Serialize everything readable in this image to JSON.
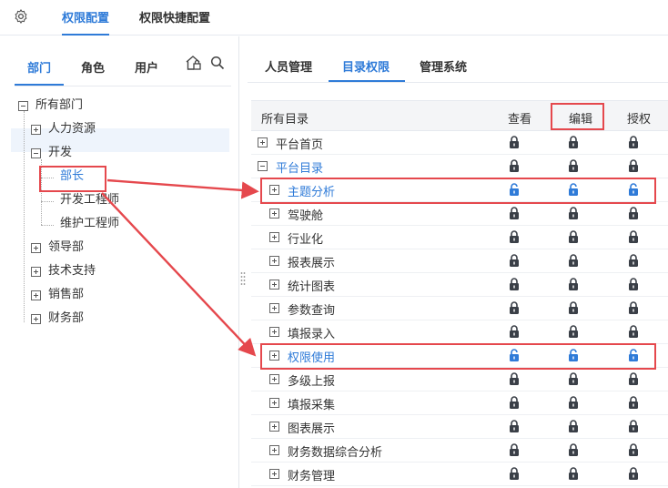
{
  "colors": {
    "accent": "#2f7bd8",
    "annotation": "#e5484d",
    "lock_locked": "#3a3f47",
    "lock_unlocked": "#2f7bd8"
  },
  "top_nav": {
    "settings_icon": "gear-icon",
    "tabs": [
      {
        "label": "权限配置",
        "active": true
      },
      {
        "label": "权限快捷配置",
        "active": false
      }
    ]
  },
  "left_panel": {
    "tabs": [
      {
        "label": "部门",
        "active": true
      },
      {
        "label": "角色",
        "active": false
      },
      {
        "label": "用户",
        "active": false
      }
    ],
    "tools": [
      "lock-home-icon",
      "search-icon"
    ],
    "tree": [
      {
        "label": "所有部门",
        "level": 0,
        "toggle": "minus"
      },
      {
        "label": "人力资源",
        "level": 1,
        "toggle": "plus"
      },
      {
        "label": "开发",
        "level": 1,
        "toggle": "minus"
      },
      {
        "label": "部长",
        "level": 2,
        "toggle": "none",
        "selected": true
      },
      {
        "label": "开发工程师",
        "level": 2,
        "toggle": "none"
      },
      {
        "label": "维护工程师",
        "level": 2,
        "toggle": "none"
      },
      {
        "label": "领导部",
        "level": 1,
        "toggle": "plus"
      },
      {
        "label": "技术支持",
        "level": 1,
        "toggle": "plus"
      },
      {
        "label": "销售部",
        "level": 1,
        "toggle": "plus"
      },
      {
        "label": "财务部",
        "level": 1,
        "toggle": "plus"
      }
    ]
  },
  "right_panel": {
    "tabs": [
      {
        "label": "人员管理",
        "active": false
      },
      {
        "label": "目录权限",
        "active": true
      },
      {
        "label": "管理系统",
        "active": false
      }
    ],
    "columns": {
      "name": "所有目录",
      "view": "查看",
      "edit": "编辑",
      "grant": "授权"
    },
    "rows": [
      {
        "label": "平台首页",
        "level": 0,
        "toggle": "plus",
        "unlocked": false
      },
      {
        "label": "平台目录",
        "level": 0,
        "toggle": "minus",
        "unlocked": false,
        "highlight": true
      },
      {
        "label": "主题分析",
        "level": 1,
        "toggle": "plus",
        "unlocked": true,
        "highlight": true
      },
      {
        "label": "驾驶舱",
        "level": 1,
        "toggle": "plus",
        "unlocked": false
      },
      {
        "label": "行业化",
        "level": 1,
        "toggle": "plus",
        "unlocked": false
      },
      {
        "label": "报表展示",
        "level": 1,
        "toggle": "plus",
        "unlocked": false
      },
      {
        "label": "统计图表",
        "level": 1,
        "toggle": "plus",
        "unlocked": false
      },
      {
        "label": "参数查询",
        "level": 1,
        "toggle": "plus",
        "unlocked": false
      },
      {
        "label": "填报录入",
        "level": 1,
        "toggle": "plus",
        "unlocked": false
      },
      {
        "label": "权限使用",
        "level": 1,
        "toggle": "plus",
        "unlocked": true,
        "highlight": true
      },
      {
        "label": "多级上报",
        "level": 1,
        "toggle": "plus",
        "unlocked": false
      },
      {
        "label": "填报采集",
        "level": 1,
        "toggle": "plus",
        "unlocked": false
      },
      {
        "label": "图表展示",
        "level": 1,
        "toggle": "plus",
        "unlocked": false
      },
      {
        "label": "财务数据综合分析",
        "level": 1,
        "toggle": "plus",
        "unlocked": false
      },
      {
        "label": "财务管理",
        "level": 1,
        "toggle": "plus",
        "unlocked": false
      }
    ]
  }
}
